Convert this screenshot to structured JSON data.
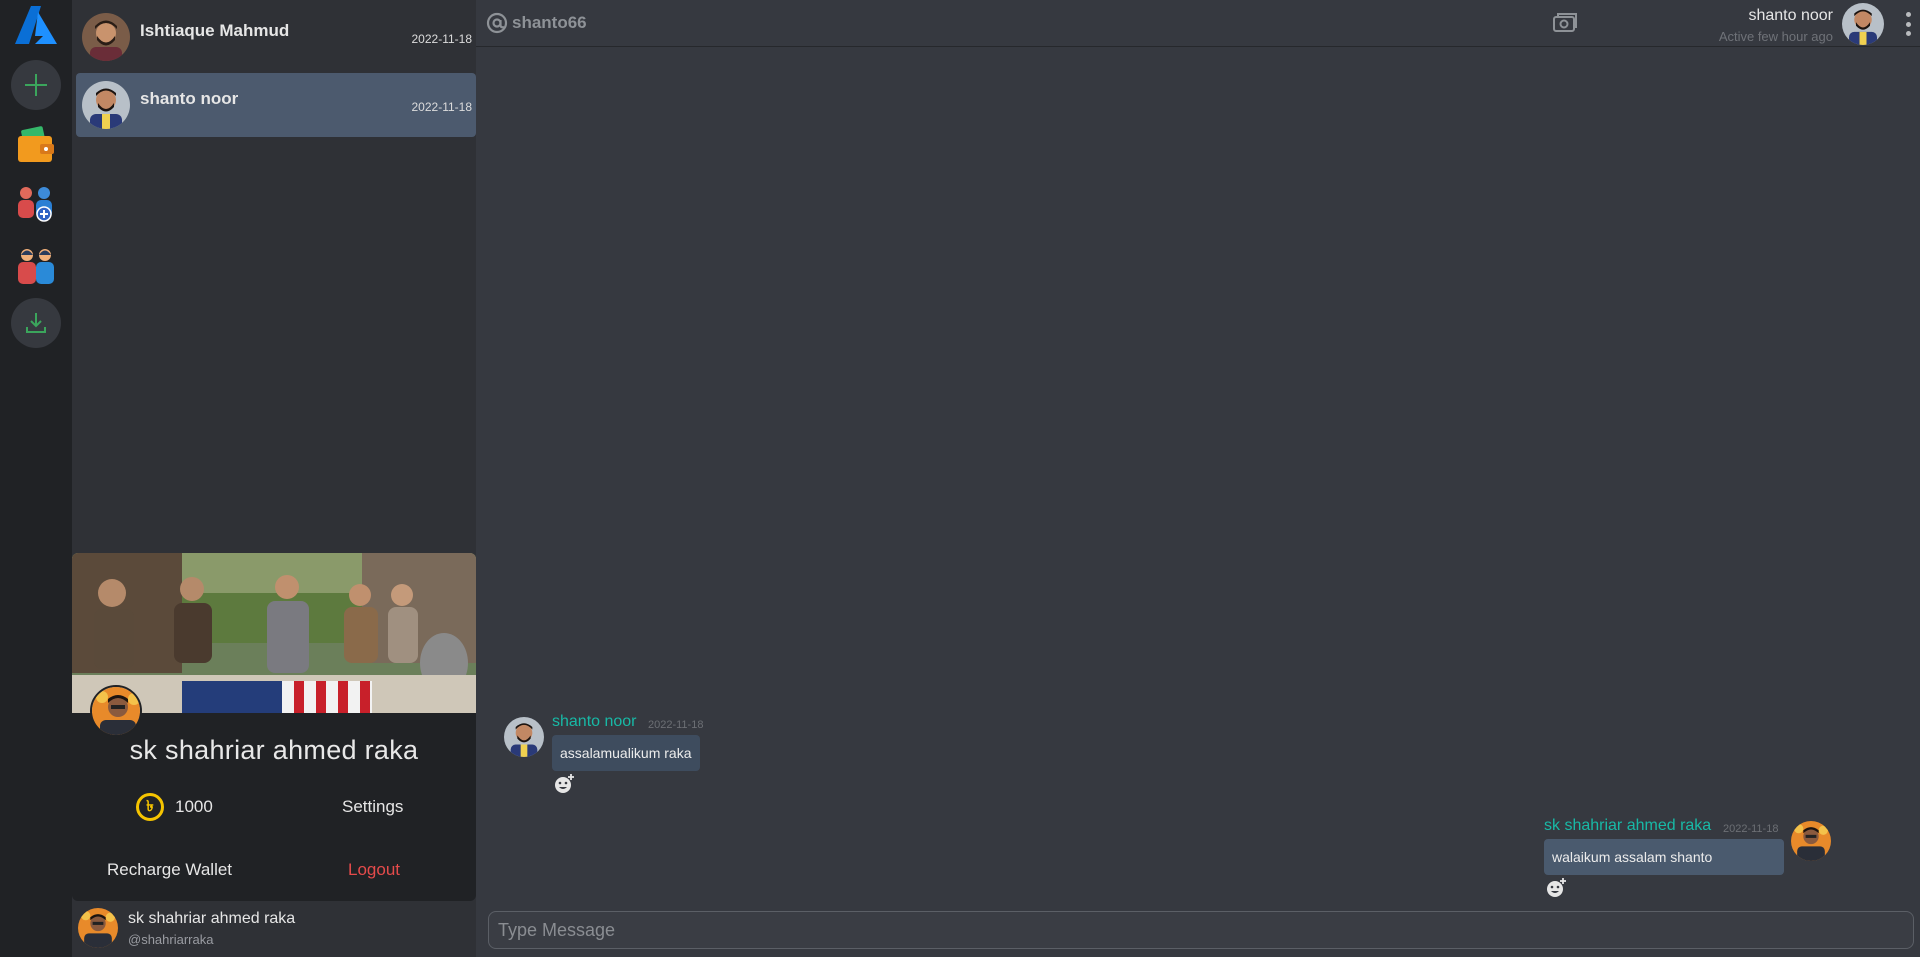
{
  "rail": {
    "items": [
      {
        "name": "app-logo"
      },
      {
        "name": "add-server-button"
      },
      {
        "name": "wallet-icon"
      },
      {
        "name": "add-group-icon"
      },
      {
        "name": "friends-icon"
      },
      {
        "name": "download-button"
      }
    ]
  },
  "contacts": [
    {
      "name": "Ishtiaque Mahmud",
      "date": "2022-11-18",
      "active": false
    },
    {
      "name": "shanto noor",
      "date": "2022-11-18",
      "active": true
    }
  ],
  "profile": {
    "name": "sk shahriar ahmed raka",
    "balance": "1000",
    "currency_symbol": "৳",
    "settings_label": "Settings",
    "recharge_label": "Recharge Wallet",
    "logout_label": "Logout"
  },
  "user": {
    "name": "sk shahriar ahmed raka",
    "handle": "@shahriarraka"
  },
  "chat": {
    "channel": "shanto66",
    "peer_name": "shanto noor",
    "peer_status": "Active few hour ago",
    "input_placeholder": "Type Message"
  },
  "messages": [
    {
      "sender": "shanto noor",
      "date": "2022-11-18",
      "text": "assalamualikum raka",
      "mine": false
    },
    {
      "sender": "sk shahriar ahmed raka",
      "date": "2022-11-18",
      "text": "walaikum assalam shanto",
      "mine": true
    }
  ],
  "colors": {
    "accent_teal": "#18b9a6",
    "logout_red": "#e54b4b",
    "coin_yellow": "#f5c400",
    "rail_bg": "#202225",
    "panel_bg": "#2f3136",
    "chat_bg": "#363940"
  }
}
